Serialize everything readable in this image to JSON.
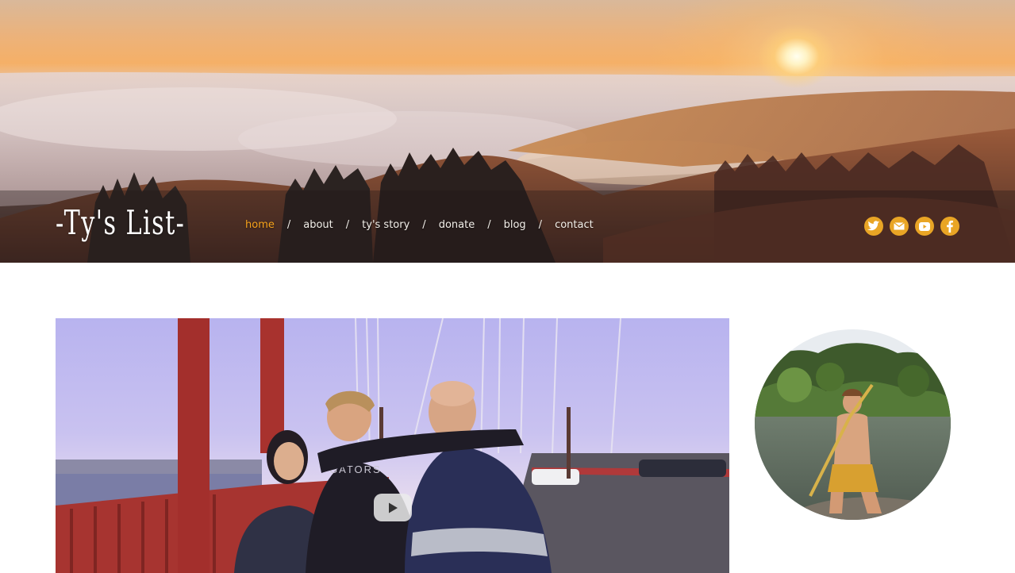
{
  "site": {
    "logo_text": "-Ty's List-"
  },
  "nav": {
    "items": [
      {
        "label": "home",
        "active": true
      },
      {
        "label": "about",
        "active": false
      },
      {
        "label": "ty's story",
        "active": false
      },
      {
        "label": "donate",
        "active": false
      },
      {
        "label": "blog",
        "active": false
      },
      {
        "label": "contact",
        "active": false
      }
    ],
    "separator": "/"
  },
  "social": {
    "icons": [
      "twitter-icon",
      "email-icon",
      "youtube-icon",
      "facebook-icon"
    ]
  },
  "colors": {
    "accent": "#e9a525",
    "nav_active": "#f6a21b",
    "nav_text": "#f2efe9",
    "background": "#ffffff"
  },
  "video": {
    "play_icon": "play-icon"
  }
}
